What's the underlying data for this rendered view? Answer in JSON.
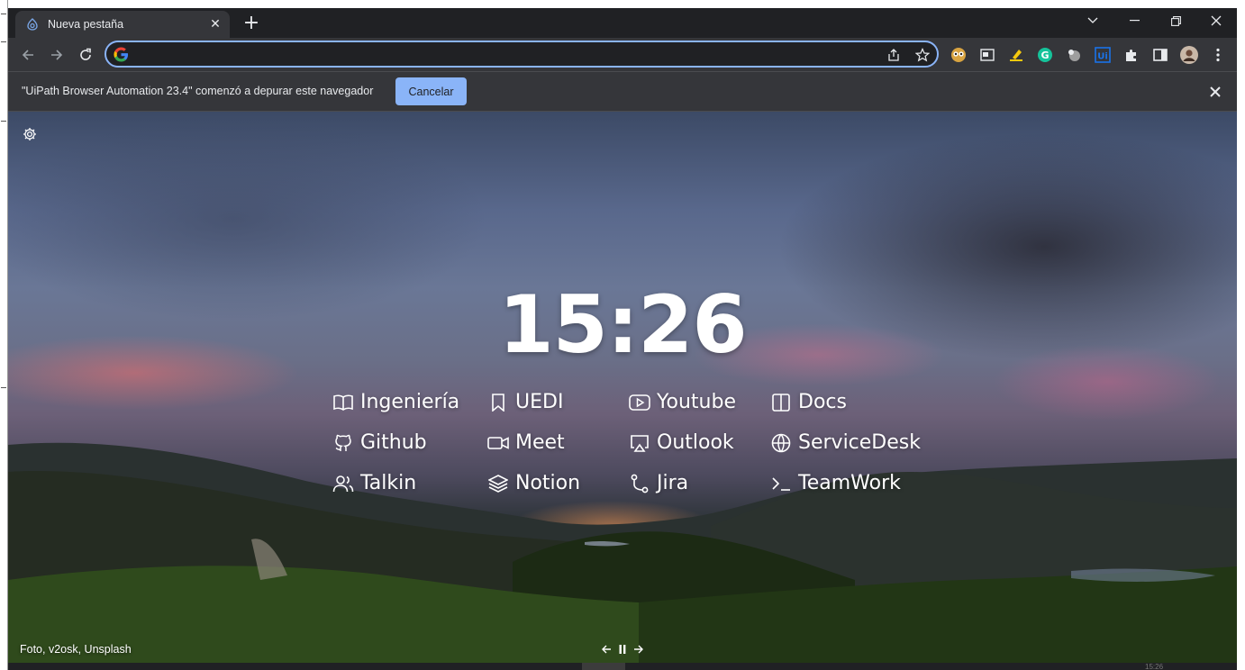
{
  "tab": {
    "title": "Nueva pestaña",
    "close_label": "✕",
    "new_tab_label": "+"
  },
  "window_controls": {
    "minimize": "—",
    "restore": "❐",
    "close": "✕"
  },
  "omnibox": {
    "value": "",
    "placeholder": ""
  },
  "infobar": {
    "message": "\"UiPath Browser Automation 23.4\" comenzó a depurar este navegador",
    "button_label": "Cancelar"
  },
  "newtab_page": {
    "clock": "15:26",
    "links": [
      {
        "label": "Ingeniería",
        "icon": "book-open-icon"
      },
      {
        "label": "UEDI",
        "icon": "bookmark-icon"
      },
      {
        "label": "Youtube",
        "icon": "youtube-icon"
      },
      {
        "label": "Docs",
        "icon": "docs-icon"
      },
      {
        "label": "Github",
        "icon": "github-icon"
      },
      {
        "label": "Meet",
        "icon": "video-icon"
      },
      {
        "label": "Outlook",
        "icon": "airplay-icon"
      },
      {
        "label": "ServiceDesk",
        "icon": "globe-icon"
      },
      {
        "label": "Talkin",
        "icon": "users-icon"
      },
      {
        "label": "Notion",
        "icon": "layers-icon"
      },
      {
        "label": "Jira",
        "icon": "git-branch-icon"
      },
      {
        "label": "TeamWork",
        "icon": "terminal-icon"
      }
    ],
    "photo_credit": "Foto, v2osk, Unsplash"
  },
  "taskbar_clock": "15:26",
  "colors": {
    "accent": "#8ab4f8",
    "chrome_dark": "#202124",
    "chrome_toolbar": "#35363a",
    "text": "#e8eaed"
  }
}
